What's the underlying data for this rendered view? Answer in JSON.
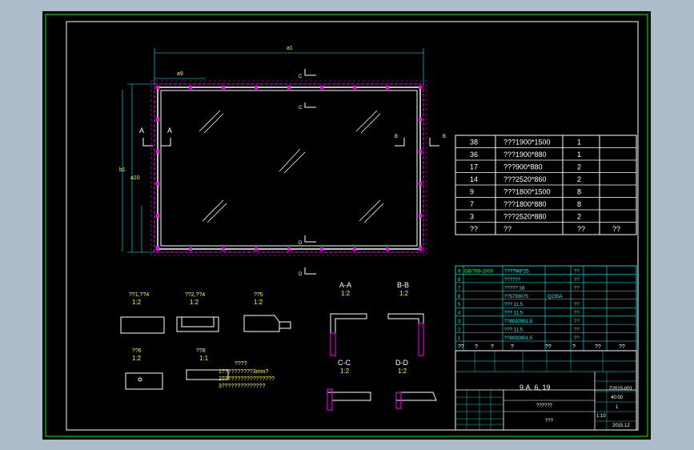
{
  "section_labels": {
    "a_left": "A",
    "a_right": "A",
    "b_left": "B",
    "b_right": "B",
    "c_top": "C",
    "c_mid": "C",
    "d_mid": "D",
    "d_bottom": "D"
  },
  "dims": {
    "top": "a1",
    "top_sub": "a9",
    "left": "b1",
    "left_sub": "a10"
  },
  "glass_table": {
    "rows": [
      {
        "no": "38",
        "spec": "???1900*1500",
        "qty": "1",
        "note": ""
      },
      {
        "no": "36",
        "spec": "???1900*880",
        "qty": "1",
        "note": ""
      },
      {
        "no": "17",
        "spec": "???900*880",
        "qty": "2",
        "note": ""
      },
      {
        "no": "14",
        "spec": "???2520*860",
        "qty": "2",
        "note": ""
      },
      {
        "no": "9",
        "spec": "???1800*1500",
        "qty": "8",
        "note": ""
      },
      {
        "no": "7",
        "spec": "???1800*880",
        "qty": "8",
        "note": ""
      },
      {
        "no": "3",
        "spec": "???2520*880",
        "qty": "2",
        "note": ""
      },
      {
        "no": "??",
        "spec": "??",
        "qty": "??",
        "note": "??"
      }
    ]
  },
  "parts_list": {
    "rows": [
      {
        "no": "9",
        "std": "GB/T69-2000",
        "name": "????M8*25",
        "qty": "??"
      },
      {
        "no": "8",
        "std": "",
        "name": "??????",
        "qty": "??"
      },
      {
        "no": "7",
        "std": "",
        "name": "????? 18",
        "qty": "??"
      },
      {
        "no": "6",
        "std": "",
        "name": "??5793075",
        "mat": "Q235A",
        "qty": ""
      },
      {
        "no": "5",
        "std": "",
        "name": "??? 11.5",
        "qty": "??"
      },
      {
        "no": "4",
        "std": "",
        "name": "??? 11.5",
        "qty": "??"
      },
      {
        "no": "3",
        "std": "",
        "name": "??8092891.5",
        "qty": "??"
      },
      {
        "no": "2",
        "std": "",
        "name": "??? 11.5",
        "qty": "??"
      },
      {
        "no": "1",
        "std": "",
        "name": "??8092891.5",
        "qty": "??"
      }
    ],
    "header": [
      "??",
      "?",
      "?",
      "?",
      "??",
      "?",
      "??",
      "??"
    ]
  },
  "title_block": {
    "project": "9.A.  6, 19",
    "drawing_no": "Z2015-001",
    "name_cell": "??????",
    "company": "???",
    "scale": "1:10",
    "sheet": "40:00",
    "count": "1",
    "date": "2015.12"
  },
  "details": {
    "d1": {
      "title": "??1,??4",
      "scale": "1:2"
    },
    "d2": {
      "title": "??2,??4",
      "scale": "1:2"
    },
    "d3": {
      "title": "??5",
      "scale": "1:2"
    },
    "d4": {
      "title": "??6",
      "scale": "1:2"
    },
    "d5": {
      "title": "??8",
      "scale": "1:1"
    },
    "aa": {
      "title": "A-A",
      "scale": "1:2"
    },
    "bb": {
      "title": "B-B",
      "scale": "1:2"
    },
    "cc": {
      "title": "C-C",
      "scale": "1:2"
    },
    "dd": {
      "title": "D-D",
      "scale": "1:2"
    }
  },
  "notes": {
    "title": "????",
    "lines": [
      "1??????????3mm?",
      "2?????????????????",
      "3??????????????"
    ]
  }
}
